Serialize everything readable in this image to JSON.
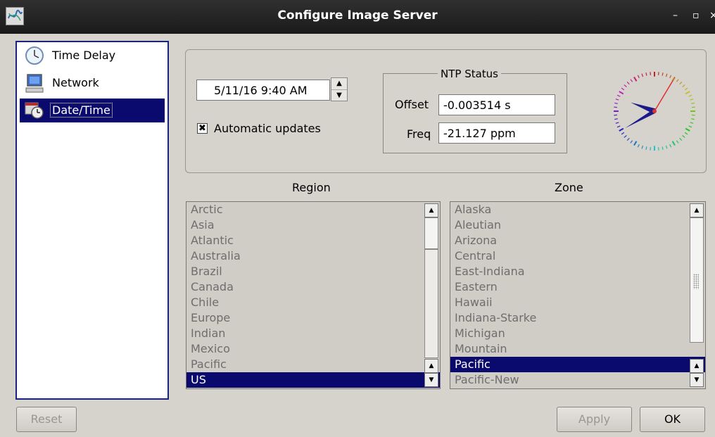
{
  "window": {
    "title": "Configure Image Server"
  },
  "nav": {
    "items": [
      {
        "label": "Time Delay",
        "icon": "clock-icon"
      },
      {
        "label": "Network",
        "icon": "computer-icon"
      },
      {
        "label": "Date/Time",
        "icon": "calendar-clock-icon"
      }
    ],
    "selected": "Date/Time"
  },
  "datetime": {
    "value": "5/11/16 9:40 AM",
    "auto_updates_label": "Automatic updates",
    "auto_updates_checked": true
  },
  "ntp": {
    "title": "NTP Status",
    "offset_label": "Offset",
    "offset_value": "-0.003514 s",
    "freq_label": "Freq",
    "freq_value": "-21.127 ppm"
  },
  "clock": {
    "hour": 9,
    "minute": 40,
    "second": 5
  },
  "region": {
    "header": "Region",
    "items": [
      "Arctic",
      "Asia",
      "Atlantic",
      "Australia",
      "Brazil",
      "Canada",
      "Chile",
      "Europe",
      "Indian",
      "Mexico",
      "Pacific",
      "US"
    ],
    "selected": "US"
  },
  "zone": {
    "header": "Zone",
    "items": [
      "Alaska",
      "Aleutian",
      "Arizona",
      "Central",
      "East-Indiana",
      "Eastern",
      "Hawaii",
      "Indiana-Starke",
      "Michigan",
      "Mountain",
      "Pacific",
      "Pacific-New"
    ],
    "selected": "Pacific"
  },
  "buttons": {
    "reset": "Reset",
    "apply": "Apply",
    "ok": "OK"
  },
  "colors": {
    "selection": "#0a0a6e",
    "title_bar": "#222222",
    "second_hand": "#e03030",
    "hour_minute_hands": "#1a1a8a"
  }
}
